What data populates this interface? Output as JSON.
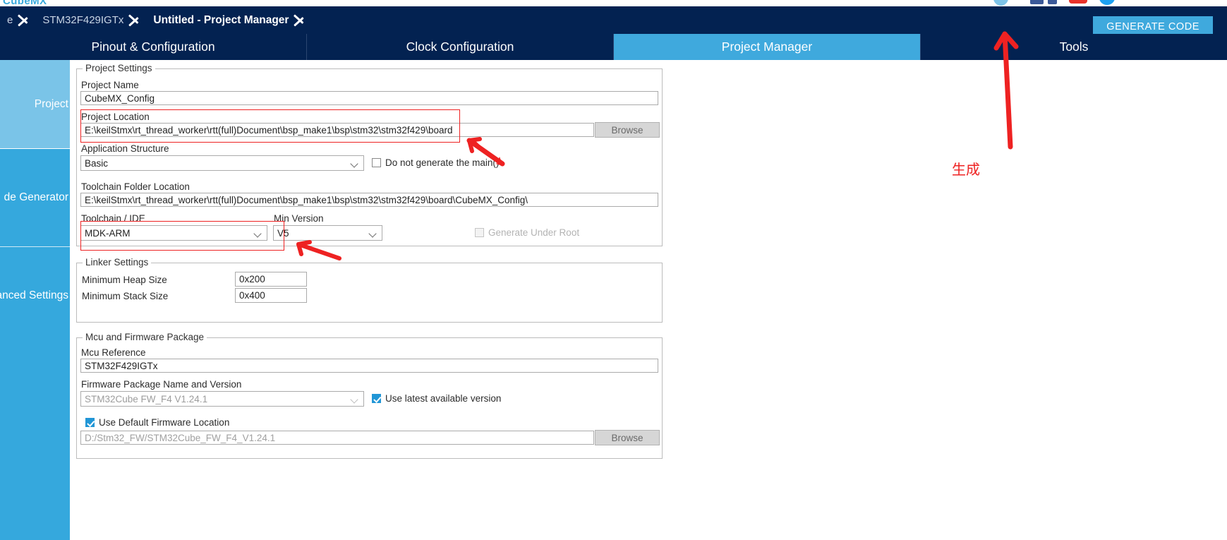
{
  "app": {
    "wordmark": "CubeMX"
  },
  "header": {
    "breadcrumbs": [
      {
        "label": "e",
        "active": false
      },
      {
        "label": "STM32F429IGTx",
        "active": false
      },
      {
        "label": "Untitled - Project Manager",
        "active": true
      }
    ],
    "generate_code_label": "GENERATE CODE",
    "social_icons": [
      "globe-icon",
      "facebook-icon",
      "facebook-icon",
      "youtube-icon",
      "twitter-icon"
    ]
  },
  "tabs": [
    {
      "label": "Pinout & Configuration",
      "active": false
    },
    {
      "label": "Clock Configuration",
      "active": false
    },
    {
      "label": "Project Manager",
      "active": true
    },
    {
      "label": "Tools",
      "active": false
    }
  ],
  "sidebar": {
    "items": [
      {
        "label": "Project",
        "active": true
      },
      {
        "label": "de Generator",
        "active": false
      },
      {
        "label": "anced Settings",
        "active": false
      }
    ]
  },
  "project_settings": {
    "group_title": "Project Settings",
    "project_name_label": "Project Name",
    "project_name_value": "CubeMX_Config",
    "project_location_label": "Project Location",
    "project_location_value": "E:\\keilStmx\\rt_thread_worker\\rtt(full)Document\\bsp_make1\\bsp\\stm32\\stm32f429\\board",
    "browse_label": "Browse",
    "application_structure_label": "Application Structure",
    "application_structure_value": "Basic",
    "do_not_generate_main_label": "Do not generate the main()",
    "do_not_generate_main_checked": false,
    "toolchain_folder_label": "Toolchain Folder Location",
    "toolchain_folder_value": "E:\\keilStmx\\rt_thread_worker\\rtt(full)Document\\bsp_make1\\bsp\\stm32\\stm32f429\\board\\CubeMX_Config\\",
    "toolchain_ide_label": "Toolchain / IDE",
    "toolchain_ide_value": "MDK-ARM",
    "min_version_label": "Min Version",
    "min_version_value": "V5",
    "generate_under_root_label": "Generate Under Root",
    "generate_under_root_checked": false
  },
  "linker_settings": {
    "group_title": "Linker Settings",
    "min_heap_label": "Minimum Heap Size",
    "min_heap_value": "0x200",
    "min_stack_label": "Minimum Stack Size",
    "min_stack_value": "0x400"
  },
  "mcu_firmware": {
    "group_title": "Mcu and Firmware Package",
    "mcu_reference_label": "Mcu Reference",
    "mcu_reference_value": "STM32F429IGTx",
    "firmware_package_label": "Firmware Package Name and Version",
    "firmware_package_value": "STM32Cube FW_F4 V1.24.1",
    "use_latest_label": "Use latest available version",
    "use_latest_checked": true,
    "use_default_location_label": "Use Default Firmware Location",
    "use_default_location_checked": true,
    "firmware_location_value": "D:/Stm32_FW/STM32Cube_FW_F4_V1.24.1",
    "browse_label": "Browse"
  },
  "annotations": {
    "generate_note": "生成",
    "accent_red": "#ee2222",
    "accent_blue": "#3fa9dd",
    "header_navy": "#032251"
  }
}
